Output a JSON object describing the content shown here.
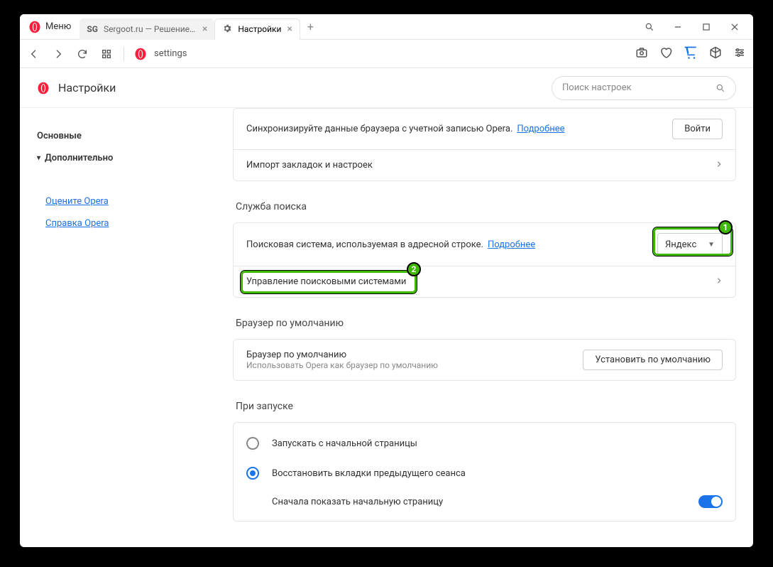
{
  "menu_label": "Меню",
  "tabs": [
    {
      "title": "Sergoot.ru — Решение ва..."
    },
    {
      "title": "Настройки"
    }
  ],
  "address_text": "settings",
  "page": {
    "title": "Настройки",
    "search_placeholder": "Поиск настроек"
  },
  "sidebar": {
    "items": [
      "Основные",
      "Дополнительно"
    ],
    "links": [
      "Оцените Opera",
      "Справка Opera"
    ]
  },
  "sync": {
    "text": "Синхронизируйте данные браузера с учетной записью Opera.",
    "more": "Подробнее",
    "login_btn": "Войти",
    "import_label": "Импорт закладок и настроек"
  },
  "search": {
    "section_title": "Служба поиска",
    "engine_text": "Поисковая система, используемая в адресной строке.",
    "more": "Подробнее",
    "selected": "Яндекс",
    "manage_label": "Управление поисковыми системами"
  },
  "default_browser": {
    "section_title": "Браузер по умолчанию",
    "title": "Браузер по умолчанию",
    "sub": "Использовать Opera как браузер по умолчанию",
    "btn": "Установить по умолчанию"
  },
  "startup": {
    "section_title": "При запуске",
    "opt1": "Запускать с начальной страницы",
    "opt2": "Восстановить вкладки предыдущего сеанса",
    "sub1": "Сначала показать начальную страницу"
  },
  "badges": {
    "one": "1",
    "two": "2"
  }
}
